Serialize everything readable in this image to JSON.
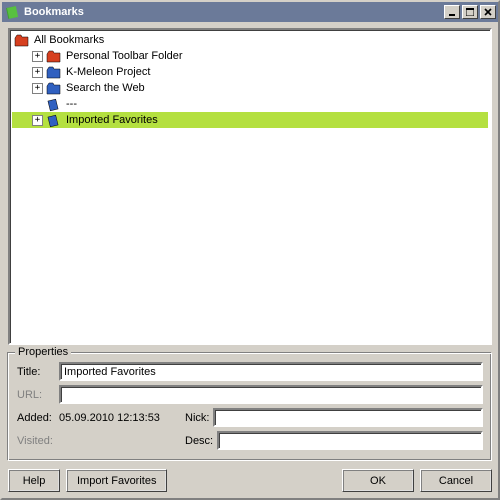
{
  "window": {
    "title": "Bookmarks"
  },
  "tree": {
    "root": "All Bookmarks",
    "items": [
      {
        "label": "Personal Toolbar Folder",
        "expandable": true,
        "icon": "folder-red"
      },
      {
        "label": "K-Meleon Project",
        "expandable": true,
        "icon": "folder-blue"
      },
      {
        "label": "Search the Web",
        "expandable": true,
        "icon": "folder-blue"
      },
      {
        "label": "---",
        "expandable": false,
        "icon": "book-blue"
      },
      {
        "label": "Imported Favorites",
        "expandable": true,
        "icon": "book-blue",
        "selected": true
      }
    ]
  },
  "properties": {
    "legend": "Properties",
    "title_label": "Title:",
    "title_value": "Imported Favorites",
    "url_label": "URL:",
    "url_value": "",
    "added_label": "Added:",
    "added_value": "05.09.2010 12:13:53",
    "nick_label": "Nick:",
    "nick_value": "",
    "visited_label": "Visited:",
    "visited_value": "",
    "desc_label": "Desc:",
    "desc_value": ""
  },
  "buttons": {
    "help": "Help",
    "import": "Import Favorites",
    "ok": "OK",
    "cancel": "Cancel"
  },
  "icons": {
    "folder_red": "#d64020",
    "folder_blue": "#3060c0",
    "book_blue": "#3060c0",
    "book_green": "#40a030"
  }
}
